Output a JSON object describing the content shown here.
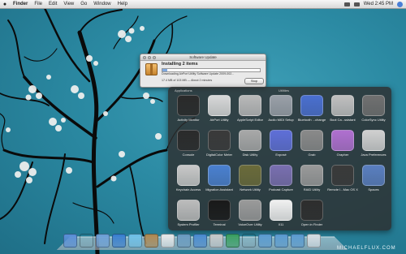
{
  "menubar": {
    "apple": "",
    "items": [
      "Finder",
      "File",
      "Edit",
      "View",
      "Go",
      "Window",
      "Help"
    ],
    "clock": "Wed 2:45 PM"
  },
  "update_window": {
    "title": "Software Update",
    "heading": "Installing 2 items",
    "progress": 0.05,
    "status": "Downloading AirPort Utility Software Update 2009-002...",
    "detail": "17.4 MB of 103 MB — About 2 minutes",
    "stop_label": "Stop"
  },
  "stack": {
    "header_left": "Applications",
    "header_right": "Utilities",
    "items": [
      {
        "label": "Activity Monitor",
        "icon": "activity-monitor-icon",
        "color": "#2a2a2a"
      },
      {
        "label": "AirPort Utility",
        "icon": "airport-icon",
        "color": "#d8d8d8"
      },
      {
        "label": "AppleScript Editor",
        "icon": "applescript-icon",
        "color": "#b9b9b9"
      },
      {
        "label": "Audio MIDI Setup",
        "icon": "midi-icon",
        "color": "#9aa0a8"
      },
      {
        "label": "Bluetooth ...change",
        "icon": "bluetooth-icon",
        "color": "#4a6fd0"
      },
      {
        "label": "Boot Ca...ssistant",
        "icon": "bootcamp-icon",
        "color": "#c0c0c0"
      },
      {
        "label": "ColorSync Utility",
        "icon": "colorsync-icon",
        "color": "#707070"
      },
      {
        "label": "Console",
        "icon": "console-icon",
        "color": "#2b2b2b"
      },
      {
        "label": "DigitalColor Meter",
        "icon": "colormeter-icon",
        "color": "#3a3a3a"
      },
      {
        "label": "Disk Utility",
        "icon": "disk-utility-icon",
        "color": "#a8a8a8"
      },
      {
        "label": "Exposé",
        "icon": "expose-icon",
        "color": "#5f6fd8"
      },
      {
        "label": "Grab",
        "icon": "grab-icon",
        "color": "#8a8a8a"
      },
      {
        "label": "Grapher",
        "icon": "grapher-icon",
        "color": "#b070d0"
      },
      {
        "label": "Java Preferences",
        "icon": "java-icon",
        "color": "#d0d0d0"
      },
      {
        "label": "Keychain Access",
        "icon": "keychain-icon",
        "color": "#c8c8c8"
      },
      {
        "label": "Migration Assistant",
        "icon": "migration-icon",
        "color": "#4a80d0"
      },
      {
        "label": "Network Utility",
        "icon": "network-icon",
        "color": "#6b6b3a"
      },
      {
        "label": "Podcast Capture",
        "icon": "podcast-icon",
        "color": "#7a6fb0"
      },
      {
        "label": "RAID Utility",
        "icon": "raid-icon",
        "color": "#9a9a9a"
      },
      {
        "label": "Remote I...Mac OS X",
        "icon": "remote-install-icon",
        "color": "#3a3a3a"
      },
      {
        "label": "Spaces",
        "icon": "spaces-icon",
        "color": "#5a7fc0"
      },
      {
        "label": "System Profiler",
        "icon": "system-profiler-icon",
        "color": "#bcbcbc"
      },
      {
        "label": "Terminal",
        "icon": "terminal-icon",
        "color": "#1a1a1a"
      },
      {
        "label": "VoiceOver Utility",
        "icon": "voiceover-icon",
        "color": "#9a9a9a"
      },
      {
        "label": "X11",
        "icon": "x11-icon",
        "color": "#f0f0f0"
      },
      {
        "label": "Open in Finder",
        "icon": "open-in-finder-icon",
        "color": "#2e2e2e"
      }
    ]
  },
  "dock_icons": [
    "finder-icon",
    "dashboard-icon",
    "mail-icon",
    "safari-icon",
    "ichat-icon",
    "address-book-icon",
    "ical-icon",
    "iphoto-icon",
    "itunes-icon",
    "preview-icon",
    "time-machine-icon",
    "system-prefs-icon",
    "downloads-stack-icon",
    "documents-stack-icon",
    "applications-stack-icon",
    "trash-icon"
  ],
  "watermark": "MICHAELFLUX.COM"
}
